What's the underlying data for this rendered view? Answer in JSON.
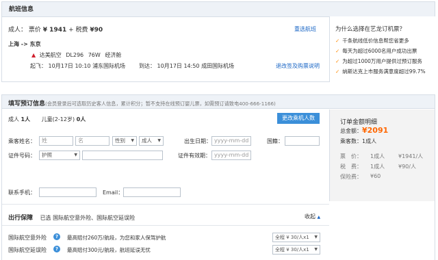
{
  "flight": {
    "title": "航班信息",
    "passenger_type": "成人：",
    "fare_label": "票价",
    "fare_value": "¥ 1941",
    "tax_label": "+ 税费",
    "tax_value": "¥90",
    "reselect_link": "重选航班",
    "route": "上海 -> 东京",
    "airline": "达美航空",
    "flight_no": "DL296",
    "plane": "76W",
    "cabin": "经济舱",
    "depart_label": "起飞：",
    "depart_time": "10月17日 10:10",
    "depart_airport": "浦东国际机场",
    "arrive_label": "到达：",
    "arrive_time": "10月17日 14:50",
    "arrive_airport": "成田国际机场",
    "rules_link": "退改签及购票说明"
  },
  "why": {
    "title": "为什么选择在艺龙订机票？",
    "items": [
      "千条航线低价信息帮您省更多",
      "每天为超过6000名用户成功出票",
      "为超过1000万用户提供过预订服务",
      "纳斯达克上市服务满意度超过99.7%"
    ]
  },
  "booking": {
    "title": "填写预订信息",
    "note": "(会员登录后可选取历史客人信息，累计积分；暂不支持在线预订婴儿票，如需预订请致电400-666-1166)",
    "adult_label": "成人",
    "adult_count": "1人",
    "child_label": "儿童(2-12岁)",
    "child_count": "0人",
    "change_btn": "更改乘机人数",
    "name_label": "乘客姓名：",
    "surname_ph": "姓",
    "given_ph": "名",
    "gender_sel": "性别",
    "ptype_sel": "成人",
    "dob_label": "出生日期：",
    "dob_ph": "yyyy-mm-dd",
    "nation_label": "国籍：",
    "id_label": "证件号码：",
    "id_type_sel": "护照",
    "expiry_label": "证件有效期：",
    "expiry_ph": "yyyy-mm-dd",
    "phone_label": "联系手机：",
    "email_label": "Email："
  },
  "insurance": {
    "title": "出行保障",
    "selected_label": "已选",
    "selected_value": "国际航空意外险、国际航空延误险",
    "collapse": "收起",
    "rows": [
      {
        "name": "国际航空意外险",
        "desc": "最高赔付260万/航段，为您和家人保驾护航",
        "option": "全程 ¥ 30/人x1"
      },
      {
        "name": "国际航空延误险",
        "desc": "最高赔付300元/航段，航班延误无忧",
        "option": "全程 ¥ 30/人x1"
      }
    ]
  },
  "summary": {
    "title": "订单金额明细",
    "total_label": "总金额：",
    "total_value": "¥2091",
    "passengers_label": "乘客数：",
    "passengers_value": "1成人",
    "fare_label": "票　价：",
    "fare_qty": "1成人",
    "fare_price": "¥1941/人",
    "tax_label": "税　费：",
    "tax_qty": "1成人",
    "tax_price": "¥90/人",
    "ins_label": "保险费：",
    "ins_price": "¥60"
  },
  "colors": {
    "accent": "#1a66c5",
    "price": "#ff6600",
    "button": "#3b8fd9",
    "check": "#ff8a00"
  }
}
